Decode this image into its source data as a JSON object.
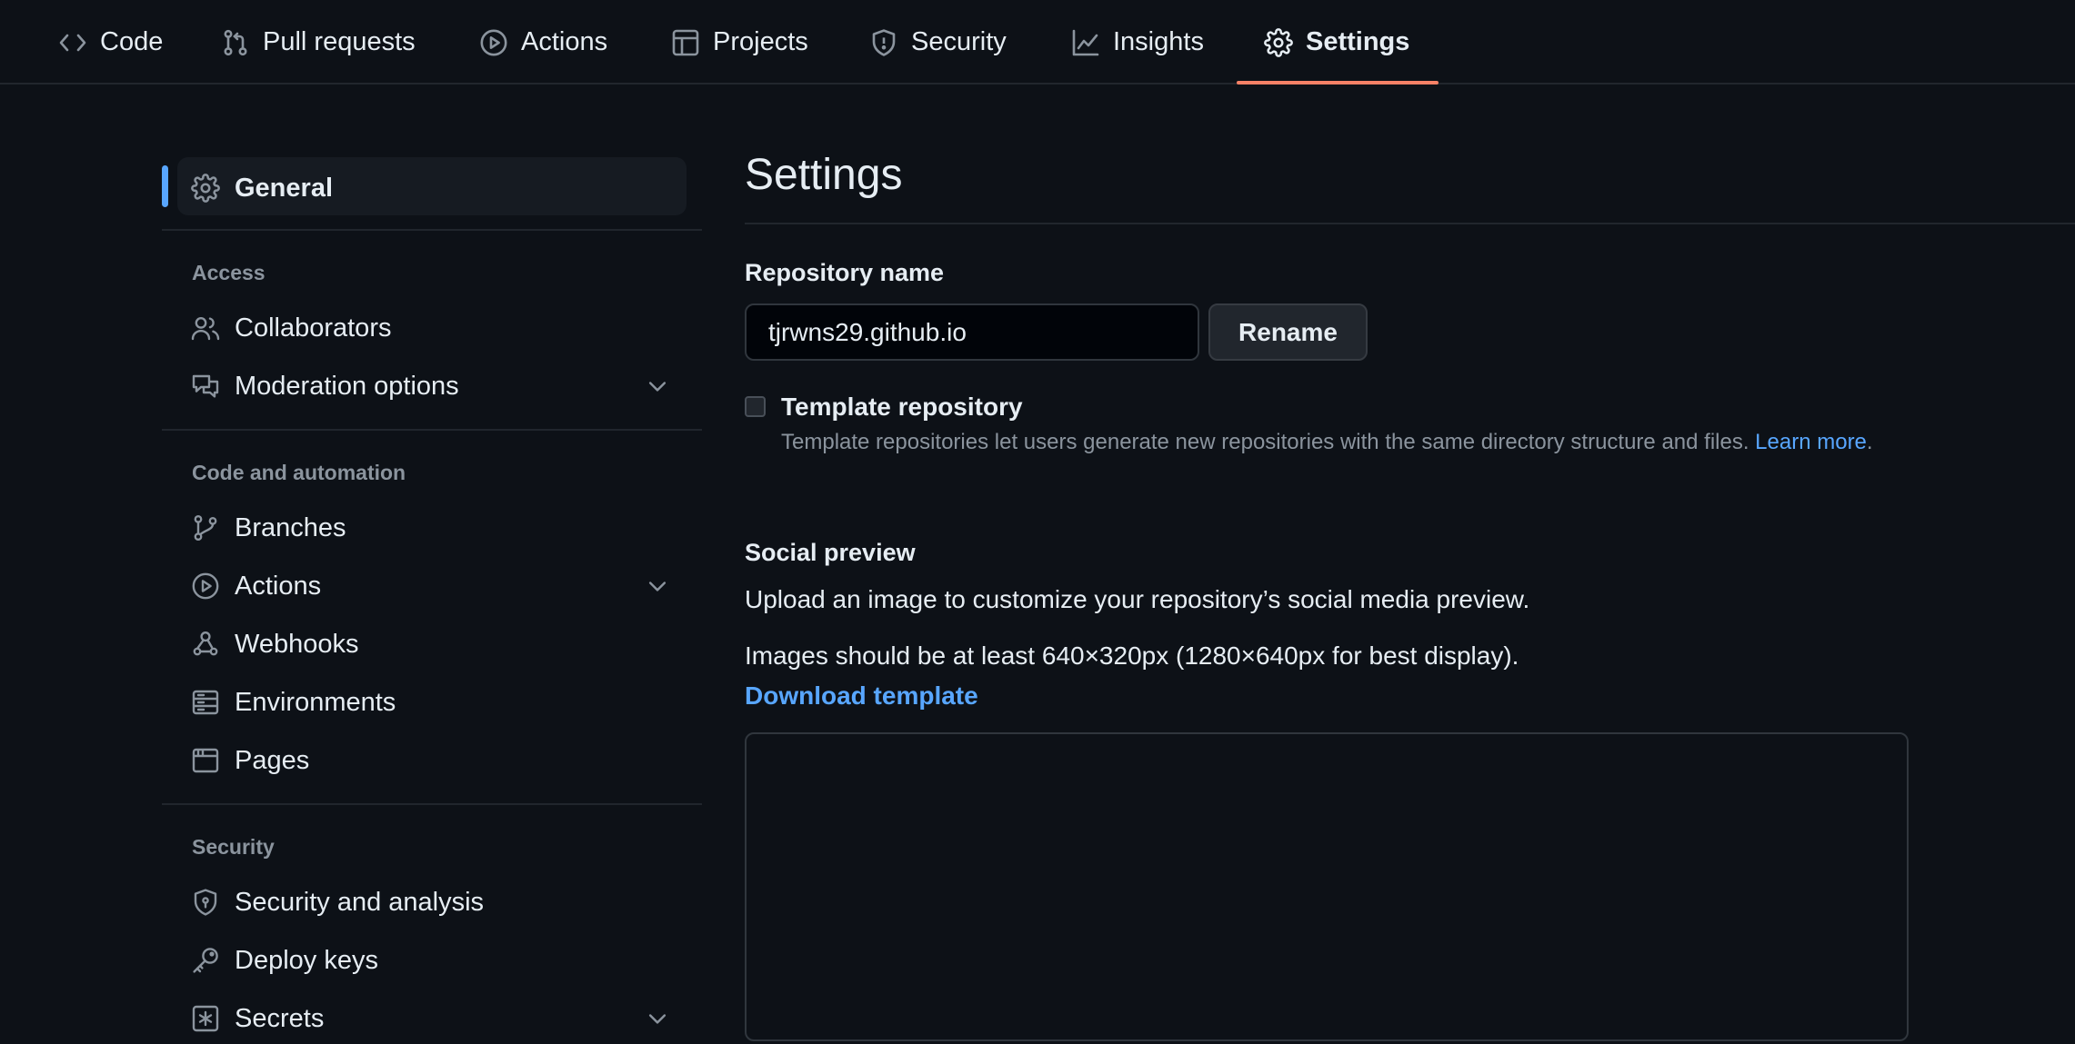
{
  "repo_nav": {
    "tabs": [
      {
        "label": "Code",
        "icon": "code-icon"
      },
      {
        "label": "Pull requests",
        "icon": "git-pull-request-icon"
      },
      {
        "label": "Actions",
        "icon": "play-circle-icon"
      },
      {
        "label": "Projects",
        "icon": "table-icon"
      },
      {
        "label": "Security",
        "icon": "shield-icon"
      },
      {
        "label": "Insights",
        "icon": "graph-icon"
      },
      {
        "label": "Settings",
        "icon": "gear-icon",
        "active": true
      }
    ],
    "active_underline_color": "#f78166"
  },
  "sidebar": {
    "general": {
      "label": "General",
      "icon": "gear-icon",
      "active": true
    },
    "sections": [
      {
        "heading": "Access",
        "items": [
          {
            "label": "Collaborators",
            "icon": "people-icon"
          },
          {
            "label": "Moderation options",
            "icon": "comment-discussion-icon",
            "expandable": true
          }
        ]
      },
      {
        "heading": "Code and automation",
        "items": [
          {
            "label": "Branches",
            "icon": "git-branch-icon"
          },
          {
            "label": "Actions",
            "icon": "play-circle-icon",
            "expandable": true
          },
          {
            "label": "Webhooks",
            "icon": "webhook-icon"
          },
          {
            "label": "Environments",
            "icon": "server-icon"
          },
          {
            "label": "Pages",
            "icon": "browser-icon"
          }
        ]
      },
      {
        "heading": "Security",
        "items": [
          {
            "label": "Security and analysis",
            "icon": "shield-lock-icon"
          },
          {
            "label": "Deploy keys",
            "icon": "key-icon"
          },
          {
            "label": "Secrets",
            "icon": "asterisk-icon",
            "expandable": true
          }
        ]
      }
    ],
    "accent_color": "#58a6ff"
  },
  "main": {
    "title": "Settings",
    "repo_name": {
      "label": "Repository name",
      "value": "tjrwns29.github.io",
      "button": "Rename"
    },
    "template": {
      "label": "Template repository",
      "checked": false,
      "help": "Template repositories let users generate new repositories with the same directory structure and files.",
      "help_link": "Learn more",
      "help_suffix": "."
    },
    "social_preview": {
      "title": "Social preview",
      "description": "Upload an image to customize your repository’s social media preview.",
      "size_note": "Images should be at least 640×320px (1280×640px for best display).",
      "download_link": "Download template"
    }
  }
}
